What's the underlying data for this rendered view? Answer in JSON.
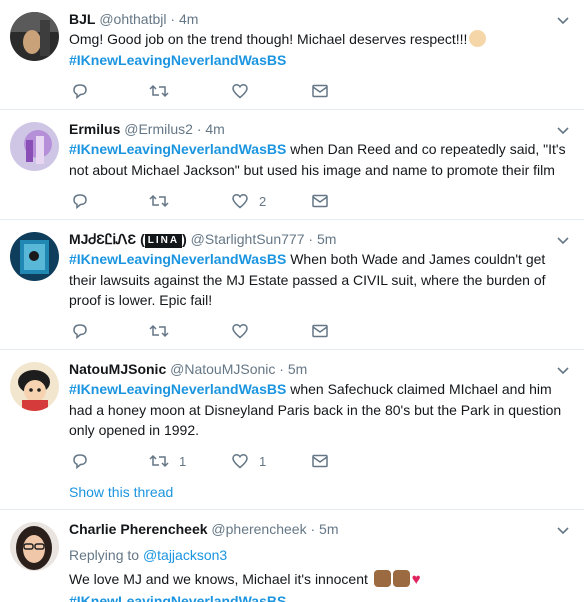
{
  "tweets": [
    {
      "name": "BJL",
      "handle": "@ohthatbjl",
      "time": "4m",
      "text": "Omg! Good job on the trend though! Michael deserves respect!!!",
      "emoji": "clapping-hands",
      "hashtag": "#IKnewLeavingNeverlandWasBS",
      "reply_count": "",
      "retweet_count": "",
      "like_count": ""
    },
    {
      "name": "Ermilus",
      "handle": "@Ermilus2",
      "time": "4m",
      "hashtag": "#IKnewLeavingNeverlandWasBS",
      "text": "when Dan Reed and co repeatedly said, \"It's not about Michael Jackson\" but used his image and name to promote their film",
      "reply_count": "",
      "retweet_count": "",
      "like_count": "2"
    },
    {
      "name_prefix": "MJᏧƐᏝᎥᏁƐ (",
      "name_badge": "LINA",
      "name_suffix": ")",
      "handle": "@StarlightSun777",
      "time": "5m",
      "hashtag": "#IKnewLeavingNeverlandWasBS",
      "text": "When both Wade and James couldn't get their lawsuits against the MJ Estate passed a CIVIL suit, where the burden of proof is lower. Epic fail!",
      "reply_count": "",
      "retweet_count": "",
      "like_count": ""
    },
    {
      "name": "NatouMJSonic",
      "handle": "@NatouMJSonic",
      "time": "5m",
      "hashtag": "#IKnewLeavingNeverlandWasBS",
      "text": "when Safechuck claimed MIchael and him had a honey moon at Disneyland Paris back in the 80's but the Park in question only opened in 1992.",
      "reply_count": "",
      "retweet_count": "1",
      "like_count": "1",
      "show_thread": "Show this thread"
    },
    {
      "name": "Charlie Pherencheek",
      "handle": "@pherencheek",
      "time": "5m",
      "replying_label": "Replying to",
      "replying_to": "@tajjackson3",
      "text": "We love MJ and we knows, Michael it's innocent",
      "emojis": [
        "victory-hand-brown",
        "victory-hand-brown",
        "red-heart"
      ],
      "hashtag": "#IKnewLeavingNeverlandWasBS"
    }
  ],
  "separator": "·",
  "colors": {
    "link": "#1b95e0",
    "muted": "#657786",
    "text": "#14171a",
    "divider": "#e6ecf0",
    "badge_red": "#e0245e"
  }
}
